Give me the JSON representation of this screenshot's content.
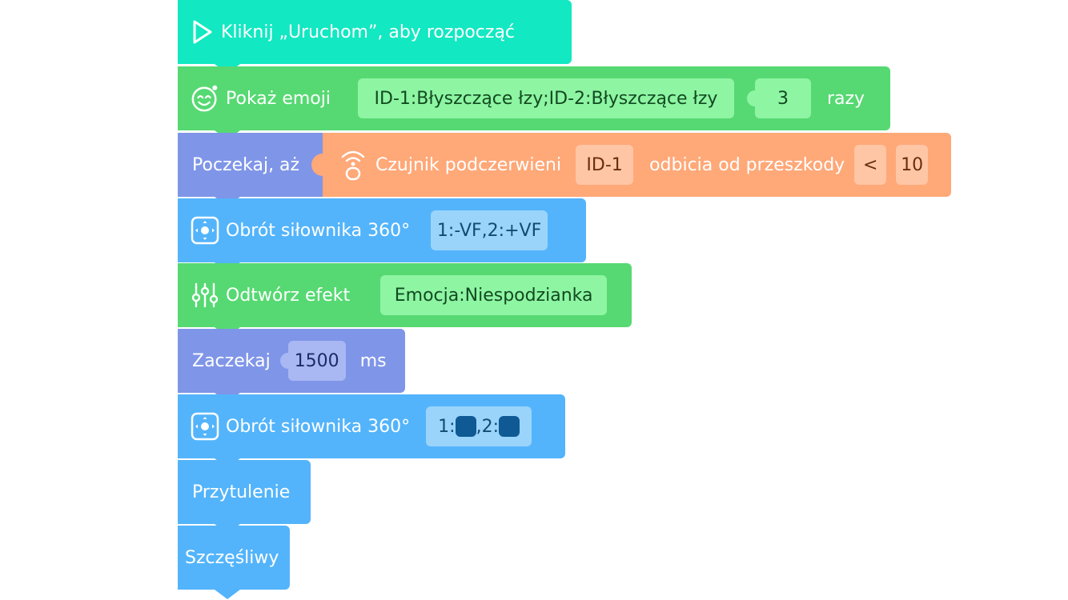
{
  "colors": {
    "start": "#12e8c2",
    "looks": "#56d972",
    "control": "#7f95e8",
    "sensor": "#ffa878",
    "motion": "#53b4fb"
  },
  "blocks": {
    "start": {
      "label": "Kliknij „Uruchom”, aby rozpocząć",
      "icon": "play-icon"
    },
    "emoji": {
      "label": "Pokaż emoji",
      "value": "ID-1:Błyszczące łzy;ID-2:Błyszczące łzy",
      "count": "3",
      "suffix": "razy",
      "icon": "emoji-face-icon"
    },
    "wait_until": {
      "label": "Poczekaj, aż",
      "sensor_label": "Czujnik podczerwieni",
      "sensor_id": "ID-1",
      "sensor_mode": "odbicia od przeszkody",
      "operator": "<",
      "value": "10",
      "icon": "infrared-sensor-icon"
    },
    "servo1": {
      "label": "Obrót siłownika 360°",
      "value": "1:-VF,2:+VF",
      "icon": "servo-icon"
    },
    "effect": {
      "label": "Odtwórz efekt",
      "value": "Emocja:Niespodzianka",
      "icon": "equalizer-icon"
    },
    "wait": {
      "label": "Zaczekaj",
      "value": "1500",
      "unit": "ms"
    },
    "servo2": {
      "label": "Obrót siłownika 360°",
      "prefix1": "1:",
      "prefix2": ",2:",
      "icon": "servo-icon"
    },
    "hug": {
      "label": "Przytulenie"
    },
    "happy": {
      "label": "Szczęśliwy"
    }
  }
}
